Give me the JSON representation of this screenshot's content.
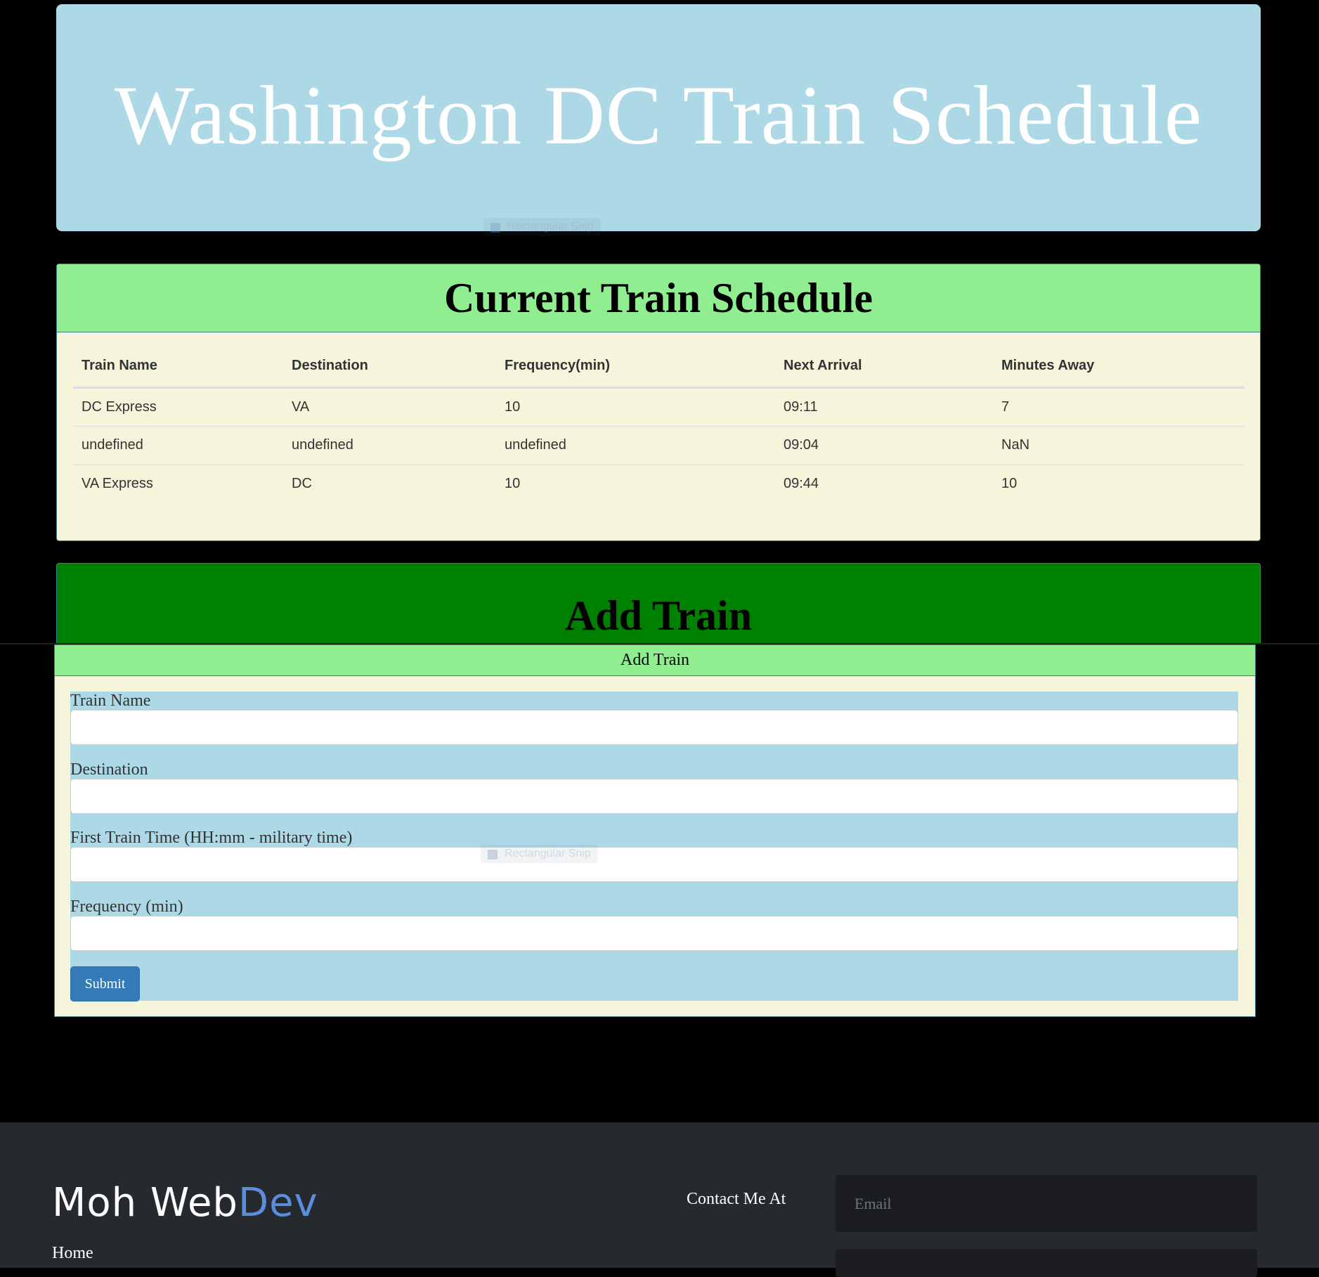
{
  "header": {
    "title": "Washington DC Train Schedule"
  },
  "overlay": {
    "ghost_label": "Rectangular Snip"
  },
  "schedule": {
    "title": "Current Train Schedule",
    "columns": [
      "Train Name",
      "Destination",
      "Frequency(min)",
      "Next Arrival",
      "Minutes Away"
    ],
    "rows": [
      [
        "DC Express",
        "VA",
        "10",
        "09:11",
        "7"
      ],
      [
        "undefined",
        "undefined",
        "undefined",
        "09:04",
        "NaN"
      ],
      [
        "VA Express",
        "DC",
        "10",
        "09:44",
        "10"
      ]
    ]
  },
  "add_train": {
    "title": "Add Train",
    "panel_heading": "Add Train",
    "fields": [
      {
        "label": "Train Name",
        "value": ""
      },
      {
        "label": "Destination",
        "value": ""
      },
      {
        "label": "First Train Time (HH:mm - military time)",
        "value": ""
      },
      {
        "label": "Frequency (min)",
        "value": ""
      }
    ],
    "submit_label": "Submit"
  },
  "footer": {
    "brand_main": "Moh Web",
    "brand_accent": "Dev",
    "home_link": "Home",
    "contact_label": "Contact Me At",
    "email_placeholder": "Email"
  },
  "colors": {
    "jumbotron_bg": "#add8e6",
    "panel_heading_bg": "#90ee90",
    "panel_body_bg": "#f5f5dc",
    "add_train_bg": "#008000",
    "submit_bg": "#337ab7",
    "footer_bg": "#26292d",
    "brand_accent": "#5b8dde"
  }
}
